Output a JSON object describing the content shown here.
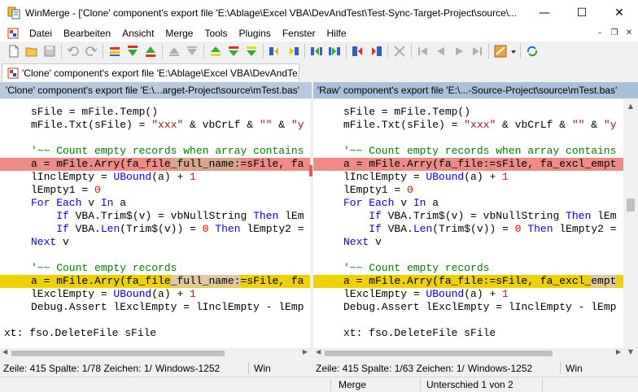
{
  "window": {
    "title": "WinMerge - ['Clone' component's export file 'E:\\Ablage\\Excel VBA\\DevAndTest\\Test-Sync-Target-Project\\source\\...",
    "minimize": "—",
    "maximize": "☐",
    "close": "✕"
  },
  "menu": {
    "items": [
      "Datei",
      "Bearbeiten",
      "Ansicht",
      "Merge",
      "Tools",
      "Plugins",
      "Fenster",
      "Hilfe"
    ],
    "mdi": [
      "–",
      "❐",
      "✕"
    ]
  },
  "tab": {
    "label": "'Clone' component's export file 'E:\\Ablage\\Excel VBA\\DevAndTe..."
  },
  "left": {
    "header": "'Clone' component's export file 'E:\\...arget-Project\\source\\mTest.bas'",
    "status": {
      "line": "Zeile: 415",
      "column": "Spalte: 1/78",
      "chars": "Zeichen: 1/",
      "encoding": "Windows-1252",
      "eol": "Win"
    }
  },
  "right": {
    "header": "'Raw' component's export file 'E:\\...-Source-Project\\source\\mTest.bas'",
    "status": {
      "line": "Zeile: 415",
      "column": "Spalte: 1/63",
      "chars": "Zeichen: 1/",
      "encoding": "Windows-1252",
      "eol": "Win"
    }
  },
  "statusbar": {
    "mode": "Merge",
    "diff": "Unterschied 1 von 2"
  },
  "colors": {
    "diff_line": "#ef8a85",
    "moved_line": "#efd000",
    "left_header": "#b8c9dd",
    "right_header": "#a9c0da"
  }
}
